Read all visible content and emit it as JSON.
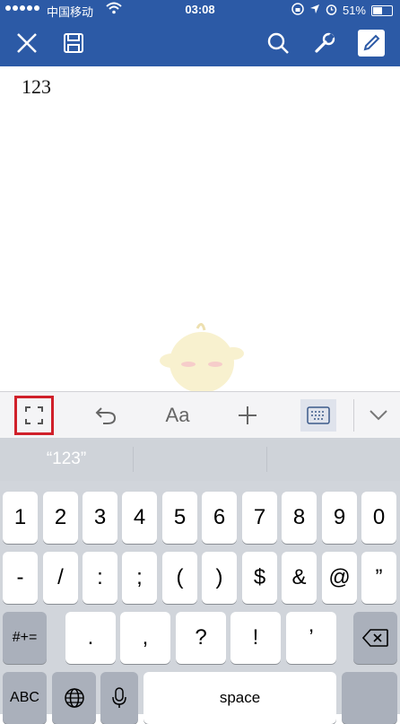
{
  "status_bar": {
    "carrier": "中国移动",
    "time": "03:08",
    "battery": "51%"
  },
  "toolbar": {
    "close_icon": "close-icon",
    "save_icon": "save-icon",
    "search_icon": "search-icon",
    "tools_icon": "wrench-icon",
    "edit_icon": "pencil-icon"
  },
  "document": {
    "text": "123"
  },
  "accessory_bar": {
    "format_label": "Aa",
    "highlight_color": "#d0202a"
  },
  "suggestions": [
    "“123”",
    "",
    ""
  ],
  "keyboard": {
    "row1": [
      "1",
      "2",
      "3",
      "4",
      "5",
      "6",
      "7",
      "8",
      "9",
      "0"
    ],
    "row2": [
      "-",
      "/",
      ":",
      ";",
      "(",
      ")",
      "$",
      "&",
      "@",
      "”"
    ],
    "row3": {
      "toggle": "#+=",
      "keys": [
        ".",
        ",",
        "?",
        "!",
        "’"
      ]
    },
    "row4": {
      "abc": "ABC",
      "space": "space"
    }
  },
  "colors": {
    "brand": "#2c5aa6",
    "keyboard_bg": "#d1d5db"
  }
}
